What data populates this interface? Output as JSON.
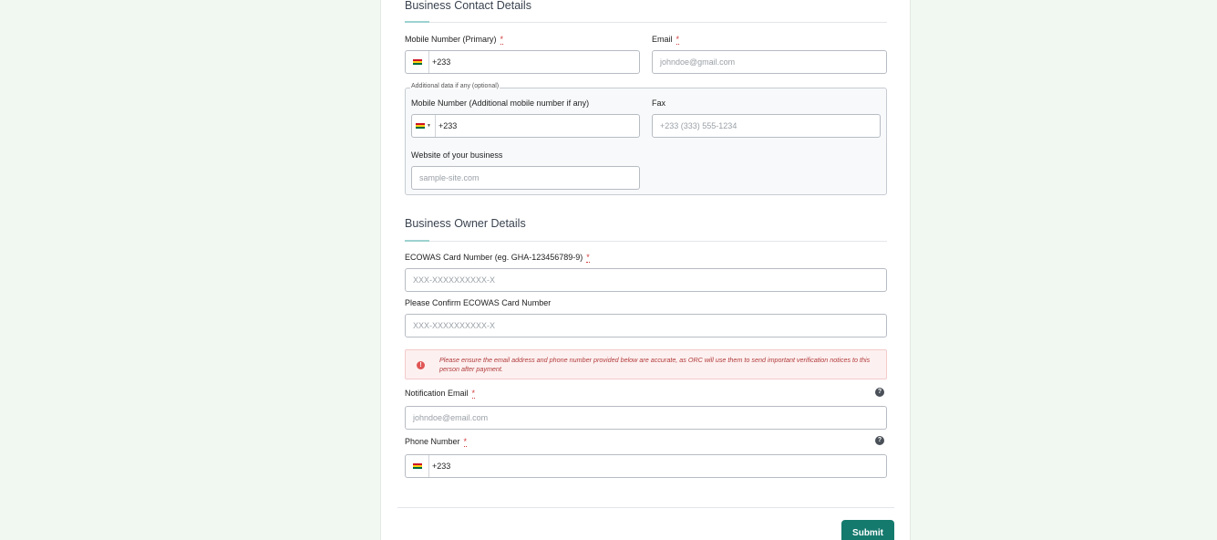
{
  "contact": {
    "title": "Business Contact Details",
    "mobile_primary_label": "Mobile Number (Primary)",
    "mobile_primary_value": "+233",
    "email_label": "Email",
    "email_placeholder": "johndoe@gmail.com",
    "optional_legend": "Additional data if any (optional)",
    "mobile_additional_label": "Mobile Number (Additional mobile number if any)",
    "mobile_additional_value": "+233",
    "fax_label": "Fax",
    "fax_placeholder": "+233 (333) 555-1234",
    "website_label": "Website of your business",
    "website_placeholder": "sample-site.com"
  },
  "owner": {
    "title": "Business Owner Details",
    "ecowas_label": "ECOWAS Card Number (eg. GHA-123456789-9)",
    "ecowas_placeholder": "XXX-XXXXXXXXXX-X",
    "ecowas_confirm_label": "Please Confirm ECOWAS Card Number",
    "ecowas_confirm_placeholder": "XXX-XXXXXXXXXX-X",
    "alert_text": "Please ensure the email address and phone number provided below are accurate, as ORC will use them to send important verification notices to this person after payment.",
    "notification_email_label": "Notification Email",
    "notification_email_placeholder": "johndoe@email.com",
    "phone_label": "Phone Number",
    "phone_value": "+233"
  },
  "required_marker": "*",
  "alert_icon": "!",
  "help_icon": "?",
  "submit_label": "Submit",
  "flag_icon": "ghana-flag-icon",
  "colors": {
    "background": "#f1f8f1",
    "accent": "#157a6e",
    "required": "#d23a3a",
    "alert_bg": "#fdf0f0",
    "alert_text": "#b13a3a"
  }
}
